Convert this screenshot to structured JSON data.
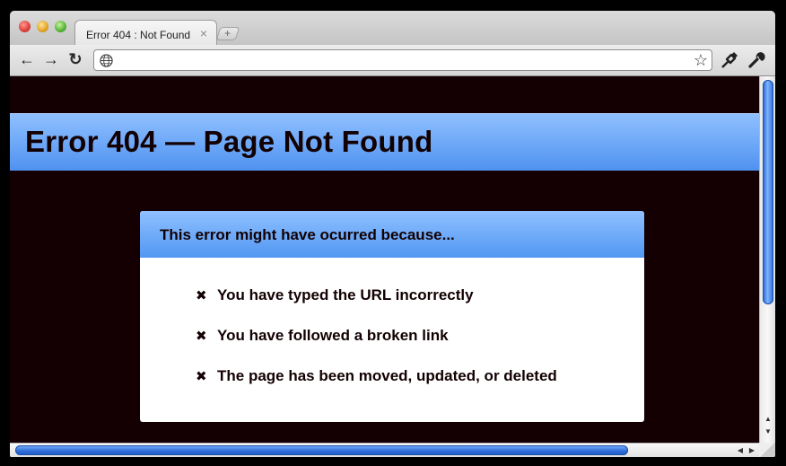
{
  "tab": {
    "title": "Error 404 : Not Found",
    "close": "×",
    "new_tab": "+"
  },
  "toolbar": {
    "back": "←",
    "forward": "→",
    "reload": "↻",
    "url": "",
    "star": "☆",
    "icons": [
      "globe-icon",
      "star-icon",
      "page-menu-icon",
      "wrench-icon"
    ]
  },
  "page": {
    "heading": "Error 404 — Page Not Found",
    "box_title": "This error might have ocurred because...",
    "bullet": "✖",
    "reasons": [
      "You have typed the URL incorrectly",
      "You have followed a broken link",
      "The page has been moved, updated, or deleted"
    ]
  },
  "colors": {
    "page_background": "#140003",
    "banner_blue": "#5a9cf3",
    "text_dark": "#120002",
    "scroll_thumb": "#2b6ad6"
  }
}
